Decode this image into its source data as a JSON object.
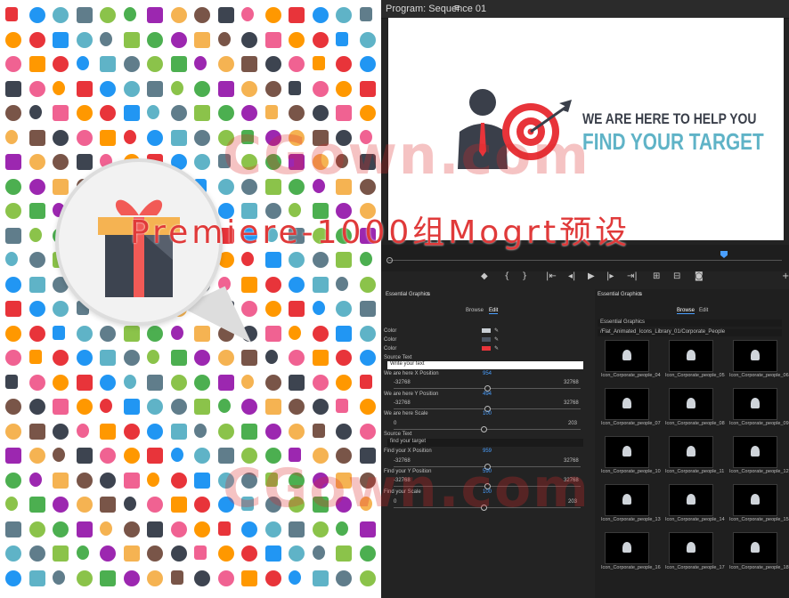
{
  "overlay": {
    "title": "Premiere-1000组Mogrt预设",
    "watermark": "CGown.com"
  },
  "monitor": {
    "tab_title": "Program: Sequence 01",
    "menu_icon": "hamburger-icon",
    "headline_1": "WE ARE HERE TO HELP YOU",
    "headline_2": "FIND YOUR TARGET"
  },
  "eg_left": {
    "panel_title": "Essential Graphics",
    "tabs": [
      "Browse",
      "Edit"
    ],
    "rows": [
      {
        "label": "Color"
      },
      {
        "label": "Color"
      },
      {
        "label": "Color"
      }
    ],
    "source_text_label": "Source Text",
    "source_text_value": "Write your text",
    "x_pos_label": "We are here X Position",
    "x_pos_value": "954",
    "y_pos_label": "We are here Y Position",
    "y_pos_value": "494",
    "scale_label": "We are here Scale",
    "scale_value": "100",
    "range_min": "-32768",
    "range_max": "32768",
    "scale_min": "0",
    "scale_max": "203",
    "source_text_label_2": "Source Text",
    "source_text_value_2": "find your target",
    "find_x_label": "Find your X Position",
    "find_x_value": "959",
    "find_y_label": "Find your Y Position",
    "find_y_value": "590",
    "find_scale_label": "Find your Scale",
    "find_scale_value": "100"
  },
  "eg_right": {
    "panel_title": "Essential Graphics",
    "tabs": [
      "Browse",
      "Edit"
    ],
    "dropdown_1": "Essential Graphics",
    "path": "/Flat_Animated_Icons_Library_01/Corporate_People",
    "items": [
      "Icon_Corporate_people_04",
      "Icon_Corporate_people_05",
      "Icon_Corporate_people_06",
      "Icon_Corporate_people_07",
      "Icon_Corporate_people_08",
      "Icon_Corporate_people_09",
      "Icon_Corporate_people_10",
      "Icon_Corporate_people_11",
      "Icon_Corporate_people_12",
      "Icon_Corporate_people_13",
      "Icon_Corporate_people_14",
      "Icon_Corporate_people_15",
      "Icon_Corporate_people_16",
      "Icon_Corporate_people_17",
      "Icon_Corporate_people_18"
    ]
  },
  "colors": {
    "accent_blue": "#4a9fff",
    "panel_bg": "#232323",
    "target_red": "#e8343a",
    "target_teal": "#5fb3c7",
    "gift_dark": "#3d4450",
    "gift_ribbon": "#f25a56",
    "gift_lid": "#f5b352"
  }
}
